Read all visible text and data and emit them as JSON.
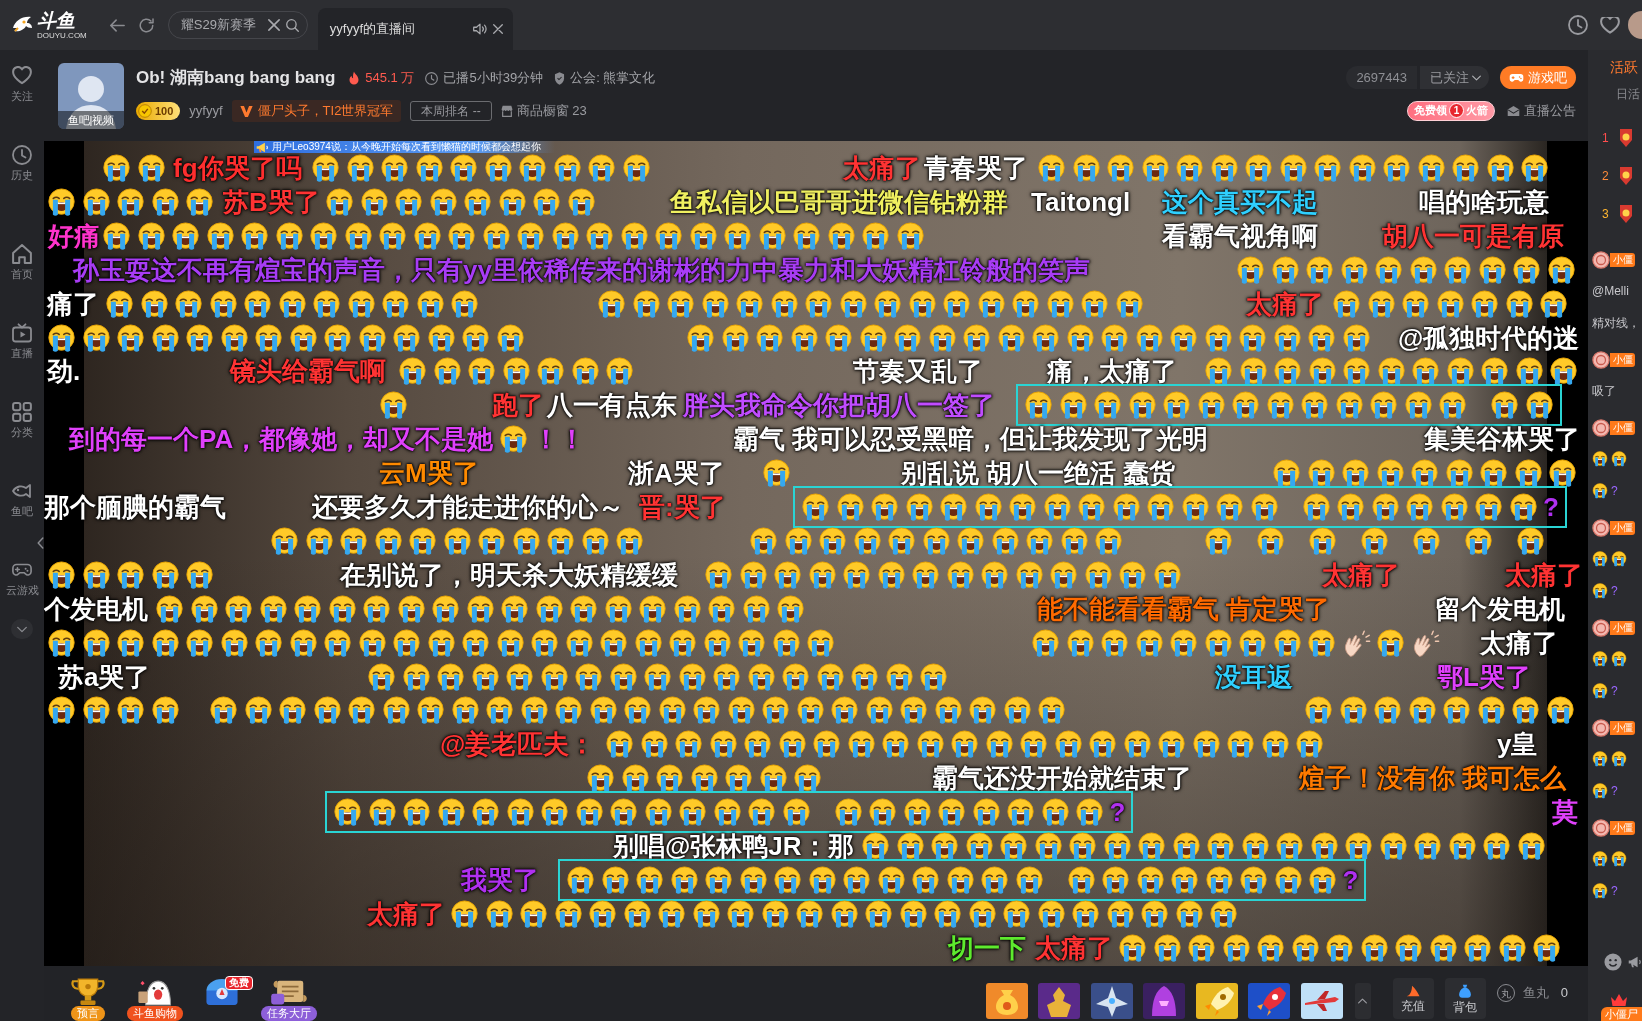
{
  "topbar": {
    "logo": {
      "text": "斗鱼",
      "subtext": "DOUYU.COM"
    },
    "tabs": [
      {
        "kind": "search",
        "label": "耀S29新赛季",
        "selected": false
      },
      {
        "kind": "page",
        "label": "yyfyyf的直播间",
        "selected": true
      }
    ]
  },
  "sidebar": {
    "items": [
      {
        "label": "关注"
      },
      {
        "label": "历史"
      },
      {
        "label": "首页"
      },
      {
        "label": "直播"
      },
      {
        "label": "分类"
      },
      {
        "label": "鱼吧"
      },
      {
        "label": "云游戏"
      }
    ]
  },
  "room": {
    "avatar_label": "鱼吧|视频",
    "title": "Ob! 湖南bang bang bang",
    "popularity": "545.1 万",
    "duration": "已播5小时39分钟",
    "guild": "公会: 熊掌文化",
    "level": "100",
    "streamer": "yyfyyf",
    "fan_title": "僵尸头子，TI2世界冠军",
    "weekly_rank": "本周排名 --",
    "shop": "商品橱窗 23",
    "room_number": "2697443",
    "follow": "已关注",
    "game_button": "游戏吧",
    "rocket_promo": {
      "prefix": "免费领",
      "count": "1",
      "suffix": "火箭"
    },
    "notice": "直播公告"
  },
  "video": {
    "broadcast": "用户Leo3974说：从今晚开始每次看到懒猫的时候都会想起你",
    "danmaku": [
      {
        "kind": "emoji",
        "outlined": false
      },
      {
        "kind": "text",
        "text": "fg你哭了吗",
        "color": "#ff2e2e",
        "outlined": false
      },
      {
        "kind": "emoji",
        "outlined": false
      },
      {
        "kind": "text",
        "text": "太痛了",
        "color": "#ff3333",
        "outlined": false
      },
      {
        "kind": "text",
        "text": "青春哭了",
        "color": "#ffffff",
        "outlined": false
      },
      {
        "kind": "emoji",
        "outlined": false
      },
      {
        "kind": "emoji",
        "outlined": false
      },
      {
        "kind": "text",
        "text": "苏B哭了",
        "color": "#ff3333",
        "outlined": false
      },
      {
        "kind": "emoji",
        "outlined": false
      },
      {
        "kind": "text",
        "text": "鱼私信以巴哥哥进微信钻粉群",
        "color": "#f0f060",
        "outlined": false
      },
      {
        "kind": "text",
        "text": "Taitongl",
        "color": "#ffffff",
        "outlined": false
      },
      {
        "kind": "text",
        "text": "这个真买不起",
        "color": "#2fd0ff",
        "outlined": false
      },
      {
        "kind": "text",
        "text": "唱的啥玩意",
        "color": "#ffffff",
        "outlined": false
      },
      {
        "kind": "text",
        "text": "好痛",
        "color": "#ff33cc",
        "outlined": false
      },
      {
        "kind": "emoji",
        "outlined": false
      },
      {
        "kind": "text",
        "text": "看霸气视角啊",
        "color": "#ffffff",
        "outlined": false
      },
      {
        "kind": "text",
        "text": "胡八一可是有原",
        "color": "#ff3333",
        "outlined": false
      },
      {
        "kind": "text",
        "text": "孙玉耍这不再有煊宝的声音，只有yy里依稀传来的谢彬的力中暴力和大妖精杠铃般的笑声",
        "color": "#a83cf5",
        "outlined": false
      },
      {
        "kind": "emoji",
        "outlined": false
      },
      {
        "kind": "text",
        "text": "痛了",
        "color": "#ffffff",
        "outlined": false
      },
      {
        "kind": "emoji",
        "outlined": false
      },
      {
        "kind": "emoji",
        "outlined": false
      },
      {
        "kind": "text",
        "text": "太痛了",
        "color": "#ff3333",
        "outlined": false
      },
      {
        "kind": "emoji",
        "outlined": false
      },
      {
        "kind": "emoji",
        "outlined": false
      },
      {
        "kind": "emoji",
        "outlined": false
      },
      {
        "kind": "text",
        "text": "@孤独时代的迷",
        "color": "#ffffff",
        "outlined": false
      },
      {
        "kind": "text",
        "text": "劲.",
        "color": "#ffffff",
        "outlined": false
      },
      {
        "kind": "text",
        "text": "镜头给霸气啊",
        "color": "#ff3333",
        "outlined": false
      },
      {
        "kind": "emoji",
        "outlined": false
      },
      {
        "kind": "text",
        "text": "节奏又乱了",
        "color": "#ffffff",
        "outlined": false
      },
      {
        "kind": "text",
        "text": "痛，太痛了",
        "color": "#ffffff",
        "outlined": false
      },
      {
        "kind": "emoji",
        "outlined": false
      },
      {
        "kind": "emoji",
        "outlined": false
      },
      {
        "kind": "text",
        "text": "跑了",
        "color": "#ff3333",
        "outlined": false
      },
      {
        "kind": "text",
        "text": "八一有点东",
        "color": "#ffffff",
        "outlined": false
      },
      {
        "kind": "text",
        "text": "胖头我命令你把胡八一签了",
        "color": "#c04cff",
        "outlined": false
      },
      {
        "kind": "emoji",
        "outlined": true
      },
      {
        "kind": "text",
        "text": "到的每一个PA，都像她，却又不是她",
        "tail": "！！",
        "color": "#e040fb",
        "outlined": false
      },
      {
        "kind": "text",
        "text": "霸气 我可以忍受黑暗，但让我发现了光明",
        "color": "#ffffff",
        "outlined": false
      },
      {
        "kind": "text",
        "text": "集美谷林哭了",
        "color": "#ffffff",
        "outlined": false
      },
      {
        "kind": "text",
        "text": "云M哭了",
        "color": "#ff8a00",
        "outlined": false
      },
      {
        "kind": "text",
        "text": "浙A哭了",
        "color": "#ffffff",
        "outlined": false
      },
      {
        "kind": "emoji",
        "outlined": false
      },
      {
        "kind": "text",
        "text": "别乱说 胡八一绝活 蠢货",
        "color": "#ffffff",
        "outlined": false
      },
      {
        "kind": "emoji",
        "outlined": false
      },
      {
        "kind": "text",
        "text": "那个腼腆的霸气",
        "color": "#ffffff",
        "outlined": false
      },
      {
        "kind": "text",
        "text": "还要多久才能走进你的心～",
        "color": "#ffffff",
        "outlined": false
      },
      {
        "kind": "text",
        "text": "晋:哭了",
        "color": "#ff3333",
        "outlined": false
      },
      {
        "kind": "emoji",
        "tail": "?",
        "color": "#b030f0",
        "outlined": true
      },
      {
        "kind": "emoji",
        "outlined": false
      },
      {
        "kind": "emoji",
        "outlined": false
      },
      {
        "kind": "emoji",
        "outlined": false
      },
      {
        "kind": "emoji",
        "outlined": false
      },
      {
        "kind": "text",
        "text": "在别说了，明天杀大妖精缓缓",
        "color": "#ffffff",
        "outlined": false
      },
      {
        "kind": "emoji",
        "outlined": false
      },
      {
        "kind": "text",
        "text": "太痛了",
        "color": "#ff3333",
        "outlined": false
      },
      {
        "kind": "text",
        "text": "太痛了",
        "color": "#ff3333",
        "outlined": false
      },
      {
        "kind": "text",
        "text": "个发电机",
        "color": "#ffffff",
        "outlined": false
      },
      {
        "kind": "emoji",
        "outlined": false
      },
      {
        "kind": "text",
        "text": "能不能看看霸气 肯定哭了",
        "color": "#ff6a00",
        "outlined": false
      },
      {
        "kind": "text",
        "text": "留个发电机",
        "color": "#ffffff",
        "outlined": false
      },
      {
        "kind": "emoji",
        "outlined": false
      },
      {
        "kind": "emoji",
        "outlined": false
      },
      {
        "kind": "text",
        "text": "太痛了",
        "color": "#ffffff",
        "outlined": false
      },
      {
        "kind": "text",
        "text": "苏a哭了",
        "color": "#ffffff",
        "outlined": false
      },
      {
        "kind": "emoji",
        "outlined": false
      },
      {
        "kind": "text",
        "text": "没耳返",
        "color": "#2fd0ff",
        "outlined": false
      },
      {
        "kind": "text",
        "text": "鄂L哭了",
        "color": "#e040fb",
        "outlined": false
      },
      {
        "kind": "emoji",
        "outlined": false
      },
      {
        "kind": "emoji",
        "outlined": false
      },
      {
        "kind": "emoji",
        "outlined": false
      },
      {
        "kind": "text",
        "text": "@姜老匹夫：",
        "color": "#ff3333",
        "outlined": false
      },
      {
        "kind": "emoji",
        "outlined": false
      },
      {
        "kind": "text",
        "text": "y皇",
        "color": "#ffffff",
        "outlined": false
      },
      {
        "kind": "emoji",
        "outlined": false
      },
      {
        "kind": "text",
        "text": "霸气还没开始就结束了",
        "color": "#ffffff",
        "outlined": false
      },
      {
        "kind": "text",
        "text": "煊子！没有你 我可怎么",
        "color": "#ff7a00",
        "outlined": false
      },
      {
        "kind": "emoji",
        "tail": "?",
        "color": "#b030f0",
        "outlined": true
      },
      {
        "kind": "text",
        "text": "莫",
        "color": "#e040fb",
        "outlined": false
      },
      {
        "kind": "text",
        "text": "别唱@张林鸭JR：那",
        "color": "#ffffff",
        "outlined": false
      },
      {
        "kind": "emoji",
        "outlined": false
      },
      {
        "kind": "text",
        "text": "我哭了",
        "color": "#b030f0",
        "outlined": false
      },
      {
        "kind": "emoji",
        "tail": "?",
        "color": "#b030f0",
        "outlined": true
      },
      {
        "kind": "text",
        "text": "太痛了",
        "color": "#ff3333",
        "outlined": false
      },
      {
        "kind": "emoji",
        "outlined": false
      },
      {
        "kind": "text",
        "text": "切一下",
        "color": "#5eea2e",
        "outlined": false
      },
      {
        "kind": "text",
        "text": "太痛了",
        "color": "#ff3333",
        "outlined": false
      },
      {
        "kind": "emoji",
        "outlined": false
      }
    ]
  },
  "bottom_bar": {
    "activities": [
      {
        "label": "预言"
      },
      {
        "label": "斗鱼购物"
      },
      {
        "badge": "免费"
      },
      {
        "label": "任务大厅"
      }
    ],
    "recharge": "充值",
    "backpack": "背包",
    "currency": {
      "symbol": "丸",
      "label": "鱼丸",
      "value": "0"
    }
  },
  "chat_panel": {
    "title": "活跃",
    "subtitle": "日活",
    "ranks": [
      {
        "rank": "1",
        "color": "#ff4d4d"
      },
      {
        "rank": "2",
        "color": "#ff8c3a"
      },
      {
        "rank": "3",
        "color": "#ffb630"
      }
    ],
    "messages": [
      {
        "kind": "text",
        "badge": "小僵",
        "lines": [
          "@Melli",
          "精对线，"
        ]
      },
      {
        "kind": "text",
        "badge": "小僵",
        "lines": [
          "吸了"
        ]
      },
      {
        "kind": "emoji",
        "badge": "小僵",
        "tail": "?",
        "color": "#9966ff"
      },
      {
        "kind": "emoji",
        "badge": "小僵",
        "tail": "?",
        "color": "#9966ff"
      },
      {
        "kind": "emoji",
        "badge": "小僵",
        "tail": "?",
        "color": "#9966ff"
      },
      {
        "kind": "emoji",
        "badge": "小僵",
        "tail": "?",
        "color": "#9966ff"
      },
      {
        "kind": "emoji",
        "badge": "小僵",
        "tail": "?",
        "color": "#9966ff"
      }
    ],
    "fan_badge": "小僵尸"
  }
}
